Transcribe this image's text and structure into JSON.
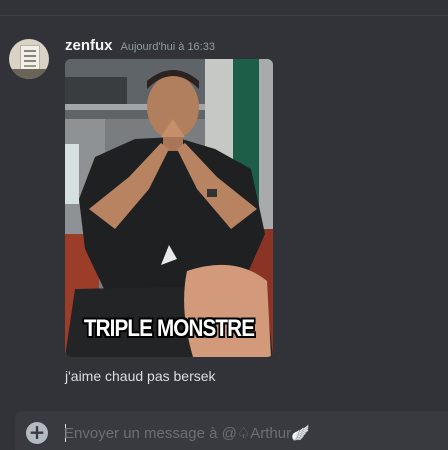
{
  "message": {
    "username": "zenfux",
    "timestamp": "Aujourd'hui à 16:33",
    "gif_caption": "TRIPLE MONSTRE",
    "text": "j'aime chaud pas bersek"
  },
  "composer": {
    "placeholder": "Envoyer un message à @♤︎Arthur🪽",
    "add_icon": "plus-circle-icon"
  },
  "colors": {
    "background": "#313338",
    "composer": "#383a40",
    "username": "#f2f3f5",
    "timestamp": "#949ba4",
    "text": "#dbdee1"
  }
}
